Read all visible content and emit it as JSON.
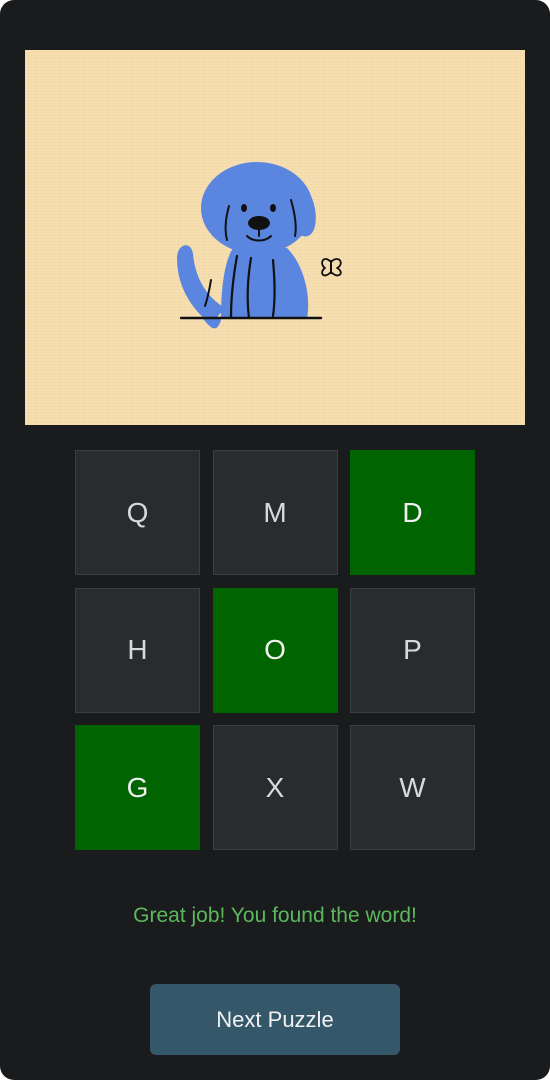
{
  "puzzle": {
    "image_subject": "dog",
    "image_background_color": "#f8dfb0",
    "illustration_color": "#5a86e0",
    "tiles": [
      {
        "letter": "Q",
        "found": false
      },
      {
        "letter": "M",
        "found": false
      },
      {
        "letter": "D",
        "found": true
      },
      {
        "letter": "H",
        "found": false
      },
      {
        "letter": "O",
        "found": true
      },
      {
        "letter": "P",
        "found": false
      },
      {
        "letter": "G",
        "found": true
      },
      {
        "letter": "X",
        "found": false
      },
      {
        "letter": "W",
        "found": false
      }
    ]
  },
  "status": {
    "message": "Great job! You found the word!",
    "message_color": "#5cb85c"
  },
  "actions": {
    "next_label": "Next Puzzle"
  },
  "colors": {
    "background": "#1a1b1d",
    "tile": "#292c2f",
    "tile_found": "#006400",
    "button": "#34576a"
  }
}
